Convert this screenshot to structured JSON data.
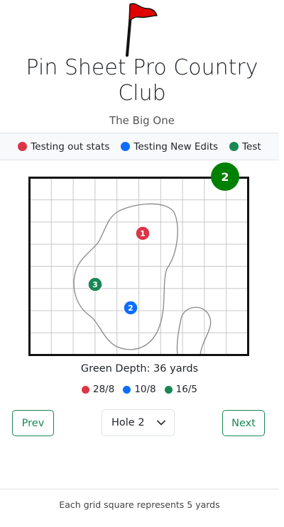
{
  "club": {
    "name": "Pin Sheet Pro Country Club",
    "subtitle": "The Big One"
  },
  "legend": [
    {
      "label": "Testing out stats",
      "color": "#dc3545"
    },
    {
      "label": "Testing New Edits",
      "color": "#0d6efd"
    },
    {
      "label": "Test",
      "color": "#198754"
    }
  ],
  "hole_badge": "2",
  "pins": [
    {
      "number": "1",
      "color": "#dc3545"
    },
    {
      "number": "2",
      "color": "#0d6efd"
    },
    {
      "number": "3",
      "color": "#198754"
    }
  ],
  "green_depth": "Green Depth: 36 yards",
  "stats": [
    {
      "value": "28/8",
      "color": "#dc3545"
    },
    {
      "value": "10/8",
      "color": "#0d6efd"
    },
    {
      "value": "16/5",
      "color": "#198754"
    }
  ],
  "nav": {
    "prev_label": "Prev",
    "next_label": "Next",
    "hole_select_value": "Hole 2"
  },
  "footer_text": "Each grid square represents 5 yards"
}
